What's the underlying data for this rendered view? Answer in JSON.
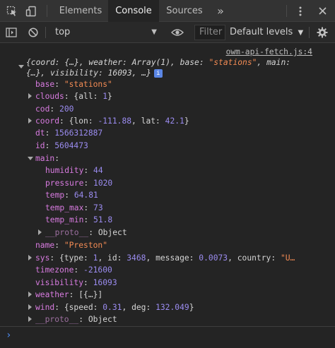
{
  "tabs": {
    "elements": "Elements",
    "console": "Console",
    "sources": "Sources",
    "more": "»"
  },
  "toolbar": {
    "context": "top",
    "filter_placeholder": "Filter",
    "levels": "Default levels"
  },
  "output": {
    "source_link": "owm-api-fetch.js:4",
    "summary_line1_a": "{coord: {…}, weather: Array(1), base: ",
    "summary_base": "\"stations\"",
    "summary_line1_b": ", main:",
    "summary_line2": "{…}, visibility: 16093, …}",
    "info_badge": "i",
    "props": {
      "base_key": "base",
      "base_val": "\"stations\"",
      "clouds_key": "clouds",
      "clouds_val_a": "{all: ",
      "clouds_val_num": "1",
      "clouds_val_b": "}",
      "cod_key": "cod",
      "cod_val": "200",
      "coord_key": "coord",
      "coord_val_a": "{lon: ",
      "coord_lon": "-111.88",
      "coord_mid": ", lat: ",
      "coord_lat": "42.1",
      "coord_end": "}",
      "dt_key": "dt",
      "dt_val": "1566312887",
      "id_key": "id",
      "id_val": "5604473",
      "main_key": "main",
      "humidity_key": "humidity",
      "humidity_val": "44",
      "pressure_key": "pressure",
      "pressure_val": "1020",
      "temp_key": "temp",
      "temp_val": "64.81",
      "temp_max_key": "temp_max",
      "temp_max_val": "73",
      "temp_min_key": "temp_min",
      "temp_min_val": "51.8",
      "main_proto_key": "__proto__",
      "main_proto_val": "Object",
      "name_key": "name",
      "name_val": "\"Preston\"",
      "sys_key": "sys",
      "sys_val_a": "{type: ",
      "sys_type": "1",
      "sys_mid1": ", id: ",
      "sys_id": "3468",
      "sys_mid2": ", message: ",
      "sys_msg": "0.0073",
      "sys_mid3": ", country: ",
      "sys_country": "\"U…",
      "timezone_key": "timezone",
      "timezone_val": "-21600",
      "visibility_key": "visibility",
      "visibility_val": "16093",
      "weather_key": "weather",
      "weather_val": "[{…}]",
      "wind_key": "wind",
      "wind_val_a": "{speed: ",
      "wind_speed": "0.31",
      "wind_mid": ", deg: ",
      "wind_deg": "132.049",
      "wind_end": "}",
      "proto_key": "__proto__",
      "proto_val": "Object"
    }
  },
  "colors": {
    "key": "#d87be0",
    "number": "#9b8cf0",
    "string": "#f28b54",
    "accent": "#4e8cf0"
  }
}
